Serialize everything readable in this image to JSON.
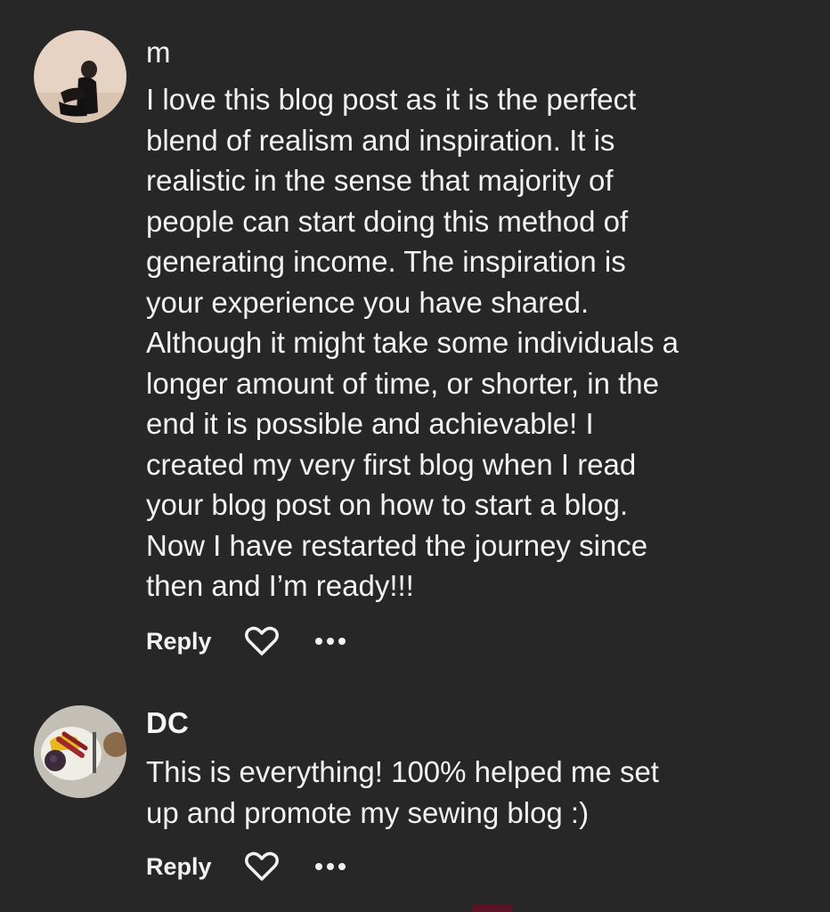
{
  "comments": [
    {
      "author": "m",
      "avatar_icon": "profile-photo-person-sitting",
      "text": "I love this blog post as it is the perfect\nblend of realism and inspiration. It is\nrealistic in the sense that majority of\npeople can start doing this method of\ngenerating income. The inspiration is\nyour experience you have shared.\nAlthough it might take some individuals a\nlonger amount of time, or shorter, in the\nend it is possible and achievable! I\ncreated my very first blog when I read\nyour blog post on how to start a blog.\nNow I have restarted the journey since\nthen and I’m ready!!!",
      "reply_label": "Reply",
      "like_icon": "heart-outline-icon",
      "more_icon": "more-dots-icon"
    },
    {
      "author": "DC",
      "avatar_icon": "profile-photo-breakfast-plate",
      "text": "This is everything! 100% helped me set\nup and promote my sewing blog :)",
      "reply_label": "Reply",
      "like_icon": "heart-outline-icon",
      "more_icon": "more-dots-icon"
    }
  ],
  "colors": {
    "background": "#272727",
    "text": "#f2f2f2"
  }
}
